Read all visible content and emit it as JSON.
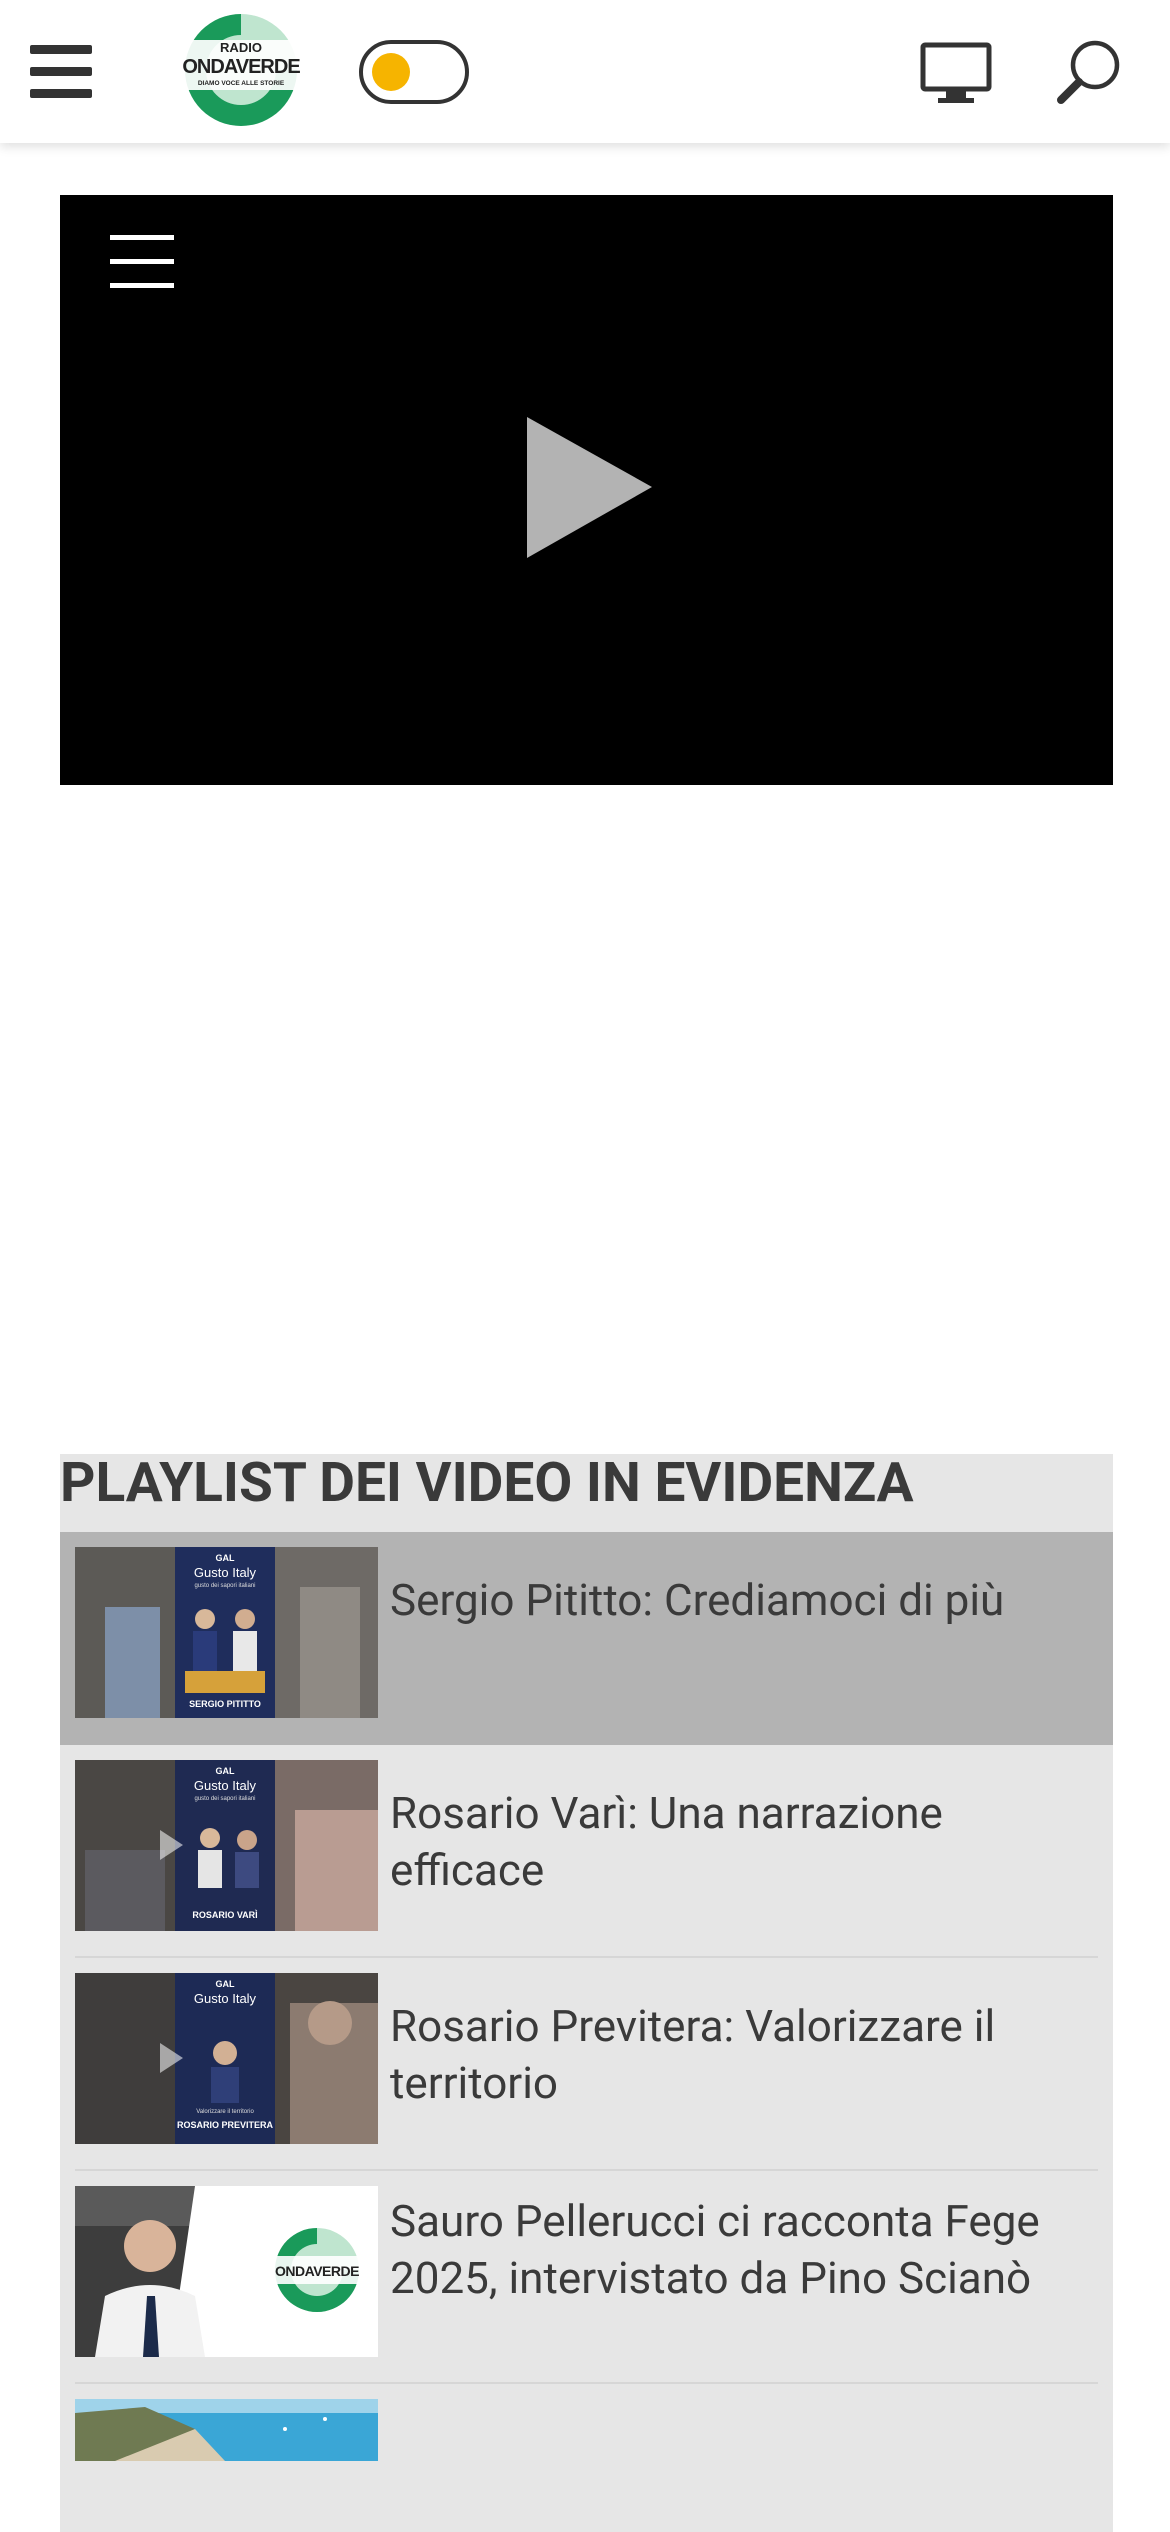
{
  "header": {
    "menu_icon": "hamburger-menu-icon",
    "logo": {
      "top_text": "RADIO",
      "brand_text": "ONDAVERDE",
      "tagline": "DIAMO VOCE ALLE STORIE",
      "colors": {
        "green": "#1a9a5a",
        "light_green": "#bfe5cf"
      }
    },
    "theme_toggle": {
      "knob_color": "#f6b400",
      "state": "light"
    },
    "tv_icon": "tv-icon",
    "search_icon": "search-icon"
  },
  "player": {
    "menu_icon": "playlist-menu-icon",
    "play_icon": "play-icon"
  },
  "playlist": {
    "title": "PLAYLIST DEI VIDEO IN EVIDENZA",
    "items": [
      {
        "title": "Sergio Pititto: Crediamoci di più",
        "active": true,
        "thumb": {
          "brand": "GAL",
          "event": "Gusto Italy",
          "subtitle": "gusto dei sapori italiani",
          "name": "SERGIO PITITTO"
        }
      },
      {
        "title": "Rosario Varì: Una narrazione efficace",
        "active": false,
        "thumb": {
          "brand": "GAL",
          "event": "Gusto Italy",
          "subtitle": "gusto dei sapori italiani",
          "name": "ROSARIO VARÌ"
        }
      },
      {
        "title": "Rosario Previtera: Valorizzare il territorio",
        "active": false,
        "thumb": {
          "brand": "GAL",
          "event": "Gusto Italy",
          "subtitle": "Valorizzare il territorio",
          "name": "ROSARIO PREVITERA"
        }
      },
      {
        "title": "Sauro Pellerucci ci racconta Fege 2025, intervistato da Pino Scianò",
        "active": false,
        "thumb": {
          "brand": "ONDAVERDE"
        }
      },
      {
        "title": "",
        "active": false,
        "thumb": {
          "scene": "coastline"
        }
      }
    ]
  },
  "colors": {
    "header_bg": "#ffffff",
    "playlist_bg": "#e6e6e6",
    "active_item_bg": "#b3b3b3",
    "text": "#3a3a3a"
  }
}
